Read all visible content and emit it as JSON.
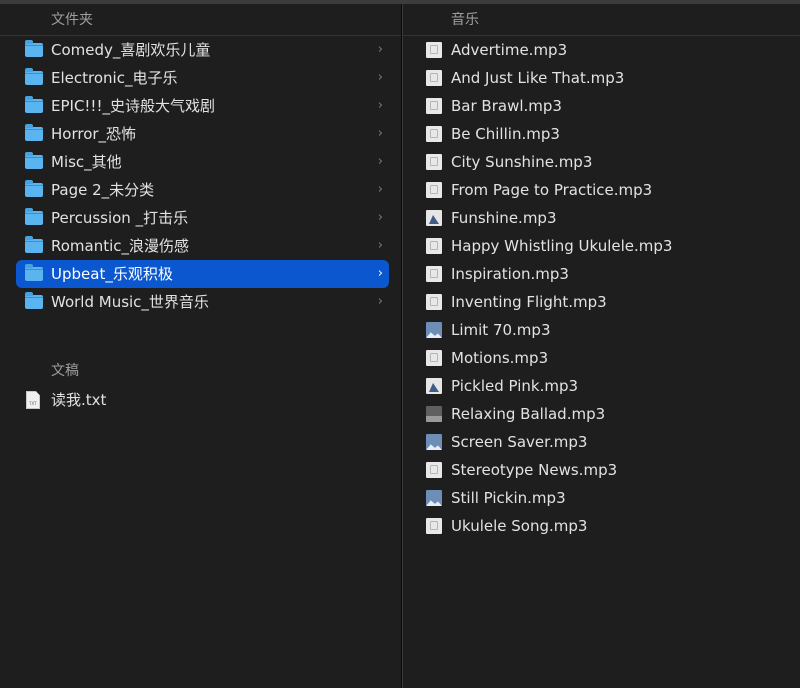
{
  "left_column": {
    "header": "文件夹",
    "folders": [
      {
        "name": "Comedy_喜剧欢乐儿童",
        "selected": false
      },
      {
        "name": "Electronic_电子乐",
        "selected": false
      },
      {
        "name": "EPIC!!!_史诗般大气戏剧",
        "selected": false
      },
      {
        "name": "Horror_恐怖",
        "selected": false
      },
      {
        "name": "Misc_其他",
        "selected": false
      },
      {
        "name": "Page 2_未分类",
        "selected": false
      },
      {
        "name": "Percussion _打击乐",
        "selected": false
      },
      {
        "name": "Romantic_浪漫伤感",
        "selected": false
      },
      {
        "name": "Upbeat_乐观积极",
        "selected": true
      },
      {
        "name": "World Music_世界音乐",
        "selected": false
      }
    ],
    "docs_header": "文稿",
    "docs": [
      {
        "name": "读我.txt",
        "icon_label": "TXT"
      }
    ]
  },
  "right_column": {
    "header": "音乐",
    "files": [
      {
        "name": "Advertime.mp3",
        "thumb": "doc"
      },
      {
        "name": "And Just Like That.mp3",
        "thumb": "doc"
      },
      {
        "name": "Bar Brawl.mp3",
        "thumb": "doc"
      },
      {
        "name": "Be Chillin.mp3",
        "thumb": "doc"
      },
      {
        "name": "City Sunshine.mp3",
        "thumb": "doc"
      },
      {
        "name": "From Page to Practice.mp3",
        "thumb": "doc"
      },
      {
        "name": "Funshine.mp3",
        "thumb": "photo"
      },
      {
        "name": "Happy Whistling Ukulele.mp3",
        "thumb": "doc"
      },
      {
        "name": "Inspiration.mp3",
        "thumb": "doc"
      },
      {
        "name": "Inventing Flight.mp3",
        "thumb": "doc"
      },
      {
        "name": "Limit 70.mp3",
        "thumb": "img"
      },
      {
        "name": "Motions.mp3",
        "thumb": "doc"
      },
      {
        "name": "Pickled Pink.mp3",
        "thumb": "photo"
      },
      {
        "name": "Relaxing Ballad.mp3",
        "thumb": "dark"
      },
      {
        "name": "Screen Saver.mp3",
        "thumb": "img"
      },
      {
        "name": "Stereotype News.mp3",
        "thumb": "doc"
      },
      {
        "name": "Still Pickin.mp3",
        "thumb": "img"
      },
      {
        "name": "Ukulele Song.mp3",
        "thumb": "doc"
      }
    ]
  },
  "icons": {
    "folder": "folder-icon",
    "chevron": "chevron-right-icon",
    "text_file": "text-file-icon",
    "audio_file": "audio-file-icon"
  },
  "colors": {
    "selection": "#0a57d0",
    "folder": "#5ab4f0",
    "background": "#1e1e1e"
  }
}
